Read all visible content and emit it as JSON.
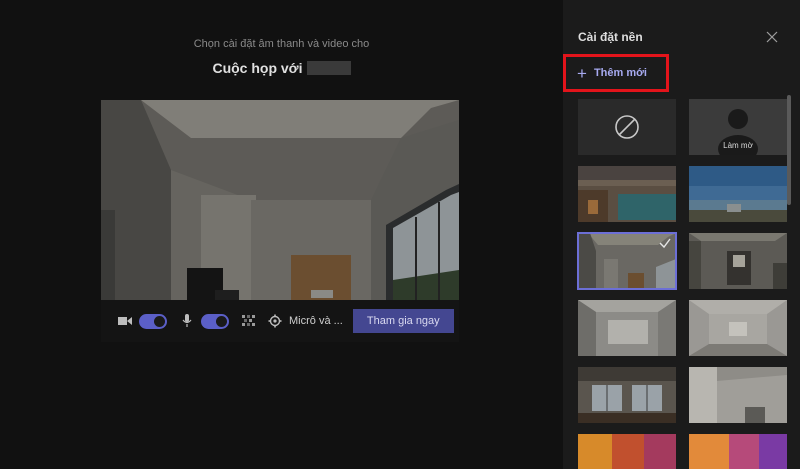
{
  "prejoin": {
    "subtitle": "Chọn cài đặt âm thanh và video cho",
    "meeting_title": "Cuộc họp với",
    "device_label": "Micrô và ...",
    "join_label": "Tham gia ngay",
    "camera_on": true,
    "mic_on": true
  },
  "panel": {
    "title": "Cài đặt nền",
    "add_new_label": "Thêm mới",
    "tiles": [
      {
        "kind": "none",
        "label": ""
      },
      {
        "kind": "blur",
        "label": "Làm mờ"
      },
      {
        "kind": "office",
        "label": ""
      },
      {
        "kind": "landscape",
        "label": ""
      },
      {
        "kind": "room-selected",
        "label": "",
        "selected": true
      },
      {
        "kind": "room-dark",
        "label": ""
      },
      {
        "kind": "room-white",
        "label": ""
      },
      {
        "kind": "room-empty",
        "label": ""
      },
      {
        "kind": "loft",
        "label": ""
      },
      {
        "kind": "studio",
        "label": ""
      },
      {
        "kind": "colorful",
        "label": ""
      },
      {
        "kind": "colorful-2",
        "label": ""
      }
    ]
  },
  "colors": {
    "accent": "#5b5fc7",
    "join_button": "#444791",
    "highlight_box": "#e3141b",
    "panel_bg": "#1b1b1b"
  }
}
